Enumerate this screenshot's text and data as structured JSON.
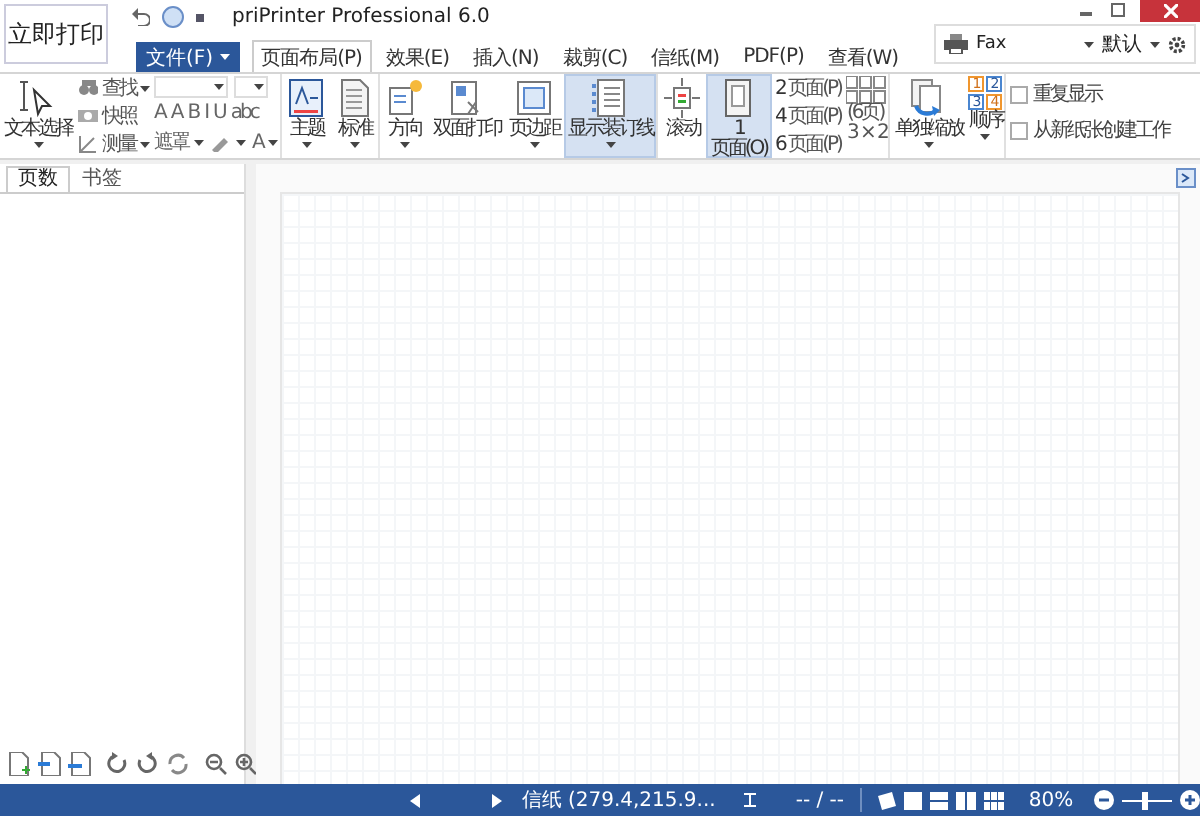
{
  "quick_print_button": "立即打印",
  "window": {
    "title": "priPrinter Professional 6.0"
  },
  "file_menu": "文件(F)",
  "tabs": [
    {
      "label": "页面布局(P)",
      "selected": true
    },
    {
      "label": "效果(E)",
      "selected": false
    },
    {
      "label": "插入(N)",
      "selected": false
    },
    {
      "label": "裁剪(C)",
      "selected": false
    },
    {
      "label": "信纸(M)",
      "selected": false
    },
    {
      "label": "PDF(P)",
      "selected": false
    },
    {
      "label": "查看(W)",
      "selected": false
    }
  ],
  "printer": {
    "name": "Fax",
    "preset": "默认"
  },
  "ribbon_groups": [
    {
      "items": [
        {
          "kind": "large",
          "label": "文本选择",
          "selected": false,
          "dropdown": true
        },
        {
          "kind": "tools",
          "items": [
            "查找",
            "快照",
            "测量"
          ]
        },
        {
          "kind": "font",
          "format_buttons": [
            "A",
            "A",
            "B",
            "I",
            "U",
            "abc"
          ],
          "mask": "遮罩",
          "font_color_button": "A"
        }
      ]
    },
    {
      "items": [
        {
          "kind": "large",
          "label": "主题",
          "selected": false,
          "dropdown": true
        },
        {
          "kind": "large",
          "label": "标准",
          "selected": false,
          "dropdown": true
        }
      ]
    },
    {
      "items": [
        {
          "kind": "large",
          "label": "方向",
          "selected": false,
          "dropdown": true
        },
        {
          "kind": "large",
          "label": "双面打印",
          "selected": false,
          "dropdown": false
        },
        {
          "kind": "large",
          "label": "页边距",
          "selected": false,
          "dropdown": true
        },
        {
          "kind": "large",
          "label": "显示装订线",
          "selected": true,
          "dropdown": true
        }
      ]
    },
    {
      "items": [
        {
          "kind": "large",
          "label": "滚动",
          "selected": false,
          "dropdown": false
        },
        {
          "kind": "large",
          "number": "1",
          "label": "页面(O)",
          "selected": true,
          "dropdown": false
        },
        {
          "kind": "pages",
          "items": [
            {
              "count": "2",
              "label": "页面(P)"
            },
            {
              "count": "4",
              "label": "页面(P)"
            },
            {
              "count": "6",
              "label": "页面(P)"
            }
          ]
        },
        {
          "kind": "grid",
          "label": "(6页)",
          "value": "3 × 2"
        }
      ]
    },
    {
      "items": [
        {
          "kind": "large",
          "label": "单独缩放",
          "selected": false,
          "dropdown": true
        },
        {
          "kind": "order",
          "cells": [
            "1",
            "2",
            "3",
            "4"
          ],
          "label": "顺序"
        }
      ]
    },
    {
      "items": [
        {
          "kind": "checks",
          "items": [
            {
              "label": "重复显示",
              "checked": false
            },
            {
              "label": "从新纸张创建工作",
              "checked": false
            }
          ]
        }
      ]
    }
  ],
  "side_panel": {
    "tabs": [
      {
        "label": "页数",
        "selected": true
      },
      {
        "label": "书签",
        "selected": false
      }
    ]
  },
  "status_bar": {
    "paper": "信纸 (279.4,215.9...",
    "page": "-- / --",
    "zoom": "80%",
    "zoom_slider": {
      "level": 0.45
    }
  }
}
